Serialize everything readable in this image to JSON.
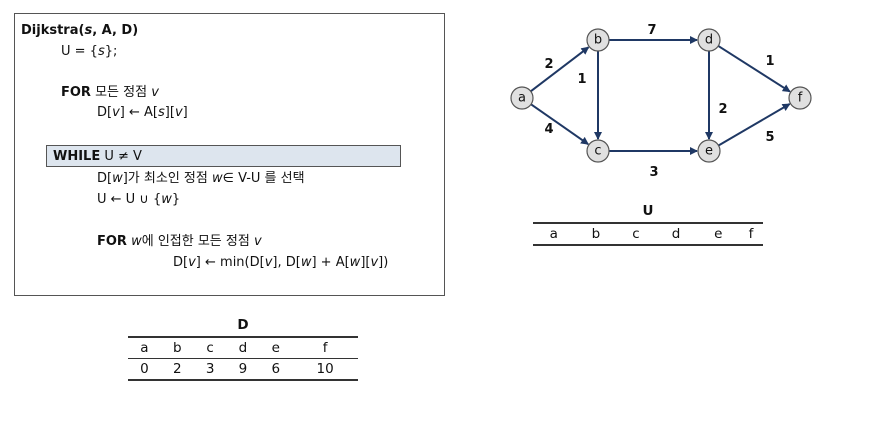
{
  "algorithm": {
    "title": {
      "name": "Dijkstra(",
      "s": "s",
      "rest": ", A, D)"
    },
    "init_u": {
      "prefix": "U = {",
      "s": "s",
      "suffix": "};"
    },
    "for1": {
      "keyword": "FOR",
      "text": " 모든 정점 ",
      "v": "v"
    },
    "for1_body": {
      "a": "D[",
      "v1": "v",
      "b": "] ← A[",
      "s": "s",
      "c": "][",
      "v2": "v",
      "d": "]"
    },
    "while": {
      "keyword": "WHILE",
      "text": " U ≠ V"
    },
    "select": {
      "a": "D[",
      "w1": "w",
      "b": "]가 최소인 정점 ",
      "w2": "w",
      "c": "∈ V-U 를 선택"
    },
    "union": {
      "a": "U ← U ∪ {",
      "w": "w",
      "b": "}"
    },
    "for2": {
      "keyword": "FOR",
      "w": "w",
      "text": "에 인접한 모든 정점 ",
      "v": "v"
    },
    "update": {
      "a": "D[",
      "v1": "v",
      "b": "] ← min(D[",
      "v2": "v",
      "c": "], D[",
      "w1": "w",
      "d": "] + A[",
      "w2": "w",
      "e": "][",
      "v3": "v",
      "f": "])"
    }
  },
  "graph": {
    "nodes": [
      "a",
      "b",
      "c",
      "d",
      "e",
      "f"
    ],
    "edges": [
      {
        "from": "a",
        "to": "b",
        "weight": "2"
      },
      {
        "from": "a",
        "to": "c",
        "weight": "4"
      },
      {
        "from": "b",
        "to": "c",
        "weight": "1"
      },
      {
        "from": "b",
        "to": "d",
        "weight": "7"
      },
      {
        "from": "c",
        "to": "e",
        "weight": "3"
      },
      {
        "from": "d",
        "to": "e",
        "weight": "2"
      },
      {
        "from": "d",
        "to": "f",
        "weight": "1"
      },
      {
        "from": "e",
        "to": "f",
        "weight": "5"
      }
    ],
    "edge_color": "#1f3864",
    "node_fill": "#e0e0e0"
  },
  "u_table": {
    "caption": "U",
    "headers": [
      "a",
      "b",
      "c",
      "d",
      "e",
      "f"
    ]
  },
  "d_table": {
    "caption": "D",
    "headers": [
      "a",
      "b",
      "c",
      "d",
      "e",
      "f"
    ],
    "values": [
      "0",
      "2",
      "3",
      "9",
      "6",
      "10"
    ]
  }
}
